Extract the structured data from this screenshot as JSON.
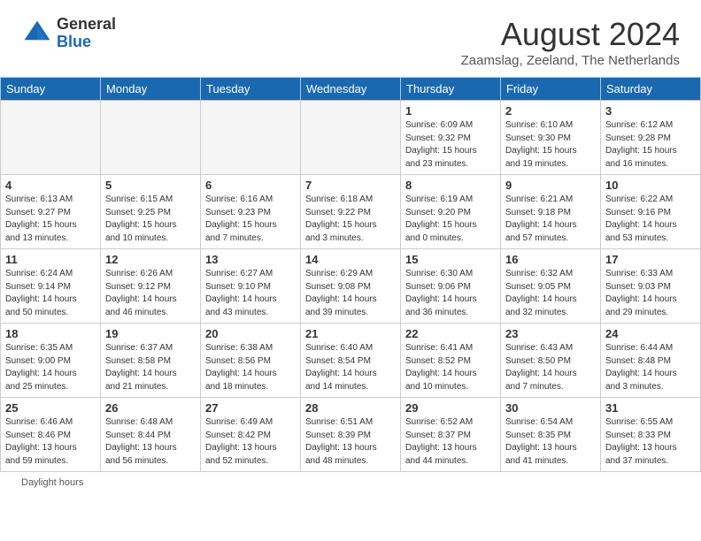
{
  "logo": {
    "general": "General",
    "blue": "Blue"
  },
  "title": "August 2024",
  "subtitle": "Zaamslag, Zeeland, The Netherlands",
  "days_of_week": [
    "Sunday",
    "Monday",
    "Tuesday",
    "Wednesday",
    "Thursday",
    "Friday",
    "Saturday"
  ],
  "weeks": [
    [
      {
        "day": "",
        "info": ""
      },
      {
        "day": "",
        "info": ""
      },
      {
        "day": "",
        "info": ""
      },
      {
        "day": "",
        "info": ""
      },
      {
        "day": "1",
        "info": "Sunrise: 6:09 AM\nSunset: 9:32 PM\nDaylight: 15 hours\nand 23 minutes."
      },
      {
        "day": "2",
        "info": "Sunrise: 6:10 AM\nSunset: 9:30 PM\nDaylight: 15 hours\nand 19 minutes."
      },
      {
        "day": "3",
        "info": "Sunrise: 6:12 AM\nSunset: 9:28 PM\nDaylight: 15 hours\nand 16 minutes."
      }
    ],
    [
      {
        "day": "4",
        "info": "Sunrise: 6:13 AM\nSunset: 9:27 PM\nDaylight: 15 hours\nand 13 minutes."
      },
      {
        "day": "5",
        "info": "Sunrise: 6:15 AM\nSunset: 9:25 PM\nDaylight: 15 hours\nand 10 minutes."
      },
      {
        "day": "6",
        "info": "Sunrise: 6:16 AM\nSunset: 9:23 PM\nDaylight: 15 hours\nand 7 minutes."
      },
      {
        "day": "7",
        "info": "Sunrise: 6:18 AM\nSunset: 9:22 PM\nDaylight: 15 hours\nand 3 minutes."
      },
      {
        "day": "8",
        "info": "Sunrise: 6:19 AM\nSunset: 9:20 PM\nDaylight: 15 hours\nand 0 minutes."
      },
      {
        "day": "9",
        "info": "Sunrise: 6:21 AM\nSunset: 9:18 PM\nDaylight: 14 hours\nand 57 minutes."
      },
      {
        "day": "10",
        "info": "Sunrise: 6:22 AM\nSunset: 9:16 PM\nDaylight: 14 hours\nand 53 minutes."
      }
    ],
    [
      {
        "day": "11",
        "info": "Sunrise: 6:24 AM\nSunset: 9:14 PM\nDaylight: 14 hours\nand 50 minutes."
      },
      {
        "day": "12",
        "info": "Sunrise: 6:26 AM\nSunset: 9:12 PM\nDaylight: 14 hours\nand 46 minutes."
      },
      {
        "day": "13",
        "info": "Sunrise: 6:27 AM\nSunset: 9:10 PM\nDaylight: 14 hours\nand 43 minutes."
      },
      {
        "day": "14",
        "info": "Sunrise: 6:29 AM\nSunset: 9:08 PM\nDaylight: 14 hours\nand 39 minutes."
      },
      {
        "day": "15",
        "info": "Sunrise: 6:30 AM\nSunset: 9:06 PM\nDaylight: 14 hours\nand 36 minutes."
      },
      {
        "day": "16",
        "info": "Sunrise: 6:32 AM\nSunset: 9:05 PM\nDaylight: 14 hours\nand 32 minutes."
      },
      {
        "day": "17",
        "info": "Sunrise: 6:33 AM\nSunset: 9:03 PM\nDaylight: 14 hours\nand 29 minutes."
      }
    ],
    [
      {
        "day": "18",
        "info": "Sunrise: 6:35 AM\nSunset: 9:00 PM\nDaylight: 14 hours\nand 25 minutes."
      },
      {
        "day": "19",
        "info": "Sunrise: 6:37 AM\nSunset: 8:58 PM\nDaylight: 14 hours\nand 21 minutes."
      },
      {
        "day": "20",
        "info": "Sunrise: 6:38 AM\nSunset: 8:56 PM\nDaylight: 14 hours\nand 18 minutes."
      },
      {
        "day": "21",
        "info": "Sunrise: 6:40 AM\nSunset: 8:54 PM\nDaylight: 14 hours\nand 14 minutes."
      },
      {
        "day": "22",
        "info": "Sunrise: 6:41 AM\nSunset: 8:52 PM\nDaylight: 14 hours\nand 10 minutes."
      },
      {
        "day": "23",
        "info": "Sunrise: 6:43 AM\nSunset: 8:50 PM\nDaylight: 14 hours\nand 7 minutes."
      },
      {
        "day": "24",
        "info": "Sunrise: 6:44 AM\nSunset: 8:48 PM\nDaylight: 14 hours\nand 3 minutes."
      }
    ],
    [
      {
        "day": "25",
        "info": "Sunrise: 6:46 AM\nSunset: 8:46 PM\nDaylight: 13 hours\nand 59 minutes."
      },
      {
        "day": "26",
        "info": "Sunrise: 6:48 AM\nSunset: 8:44 PM\nDaylight: 13 hours\nand 56 minutes."
      },
      {
        "day": "27",
        "info": "Sunrise: 6:49 AM\nSunset: 8:42 PM\nDaylight: 13 hours\nand 52 minutes."
      },
      {
        "day": "28",
        "info": "Sunrise: 6:51 AM\nSunset: 8:39 PM\nDaylight: 13 hours\nand 48 minutes."
      },
      {
        "day": "29",
        "info": "Sunrise: 6:52 AM\nSunset: 8:37 PM\nDaylight: 13 hours\nand 44 minutes."
      },
      {
        "day": "30",
        "info": "Sunrise: 6:54 AM\nSunset: 8:35 PM\nDaylight: 13 hours\nand 41 minutes."
      },
      {
        "day": "31",
        "info": "Sunrise: 6:55 AM\nSunset: 8:33 PM\nDaylight: 13 hours\nand 37 minutes."
      }
    ]
  ],
  "legend": {
    "daylight_label": "Daylight hours"
  }
}
